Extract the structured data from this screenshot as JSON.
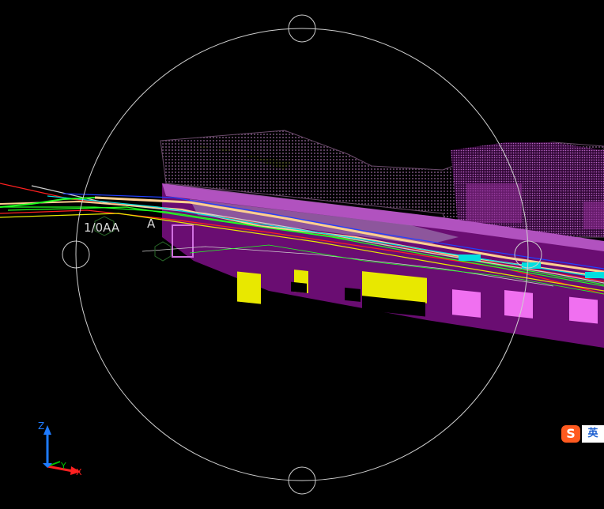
{
  "viewport": {
    "background": "#000000",
    "orbit_guide_color": "#cfcfcf"
  },
  "annotations": {
    "label_left": "1/0AA",
    "label_a": "A"
  },
  "ucs_icon": {
    "z_label": "Z",
    "y_label": "Y",
    "x_label": "X",
    "z_color": "#1e7bff",
    "y_color": "#00c000",
    "x_color": "#ff2020"
  },
  "ime": {
    "logo": "S",
    "mode": "英",
    "logo_color": "#ff5a1f",
    "mode_color": "#1c5fd0"
  },
  "model_colors": {
    "building": "#6a0d72",
    "building_light": "#d070e0",
    "roof_dots": "#9a6aa0",
    "windows_yellow": "#e8e800",
    "windows_pink": "#f070f0",
    "cyan": "#00e0e0",
    "green": "#20ff20",
    "red": "#ff2020",
    "peach": "#ffd090"
  }
}
